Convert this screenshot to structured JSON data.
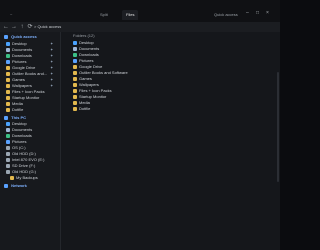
{
  "window": {
    "tabs": [
      {
        "label": "~"
      },
      {
        "label": "Split"
      },
      {
        "label": "Files"
      },
      {
        "label": "Quick access"
      }
    ],
    "controls": [
      "–",
      "□",
      "×"
    ]
  },
  "toolbar": {
    "breadcrumb": "> Quick access"
  },
  "sidebar": {
    "quick_access_label": "Quick access",
    "pinned": [
      "Desktop",
      "Documents",
      "Downloads",
      "Pictures",
      "Google Drive",
      "Outlier Books and...",
      "Games",
      "Wallpapers",
      "Files + Icon Packs",
      "Startup Monitor",
      "Media",
      "Dotfile"
    ],
    "this_pc_label": "This PC",
    "this_pc": [
      "Desktop",
      "Documents",
      "Downloads",
      "Pictures",
      "OS (C:)",
      "Old HDD (D:)",
      "Intel 870 EVO (E:)",
      "SD Drive (F:)",
      "Old HDD (G:)",
      "My Backups"
    ],
    "network_label": "Network"
  },
  "content": {
    "group_label": "Folders (12)",
    "items": [
      "Desktop",
      "Documents",
      "Downloads",
      "Pictures",
      "Google Drive",
      "Outlier Books and Software",
      "Games",
      "Wallpapers",
      "Files + Icon Packs",
      "Startup Monitor",
      "Media",
      "Dotfile"
    ]
  },
  "colors": {
    "accent": "#5aa2ff",
    "folder": "#e2b84d",
    "drive": "#9aa6b2"
  }
}
